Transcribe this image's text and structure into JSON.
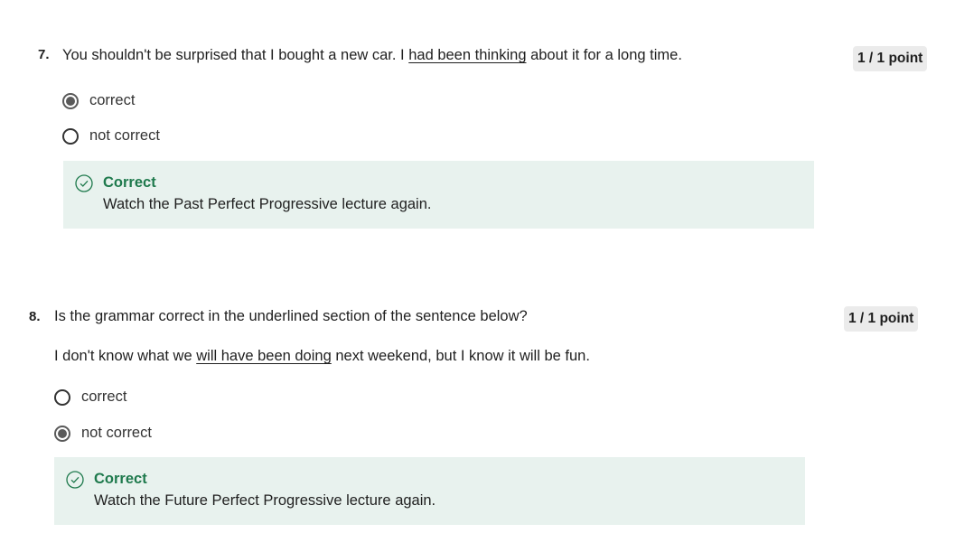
{
  "questions": [
    {
      "number": "7.",
      "prompt_parts": [
        "You shouldn't be surprised that I bought a new car. I ",
        "had been thinking",
        " about it for a long time."
      ],
      "points": "1 / 1 point",
      "options": [
        {
          "label": "correct",
          "checked": true
        },
        {
          "label": "not correct",
          "checked": false
        }
      ],
      "feedback": {
        "title": "Correct",
        "text": "Watch the Past Perfect Progressive lecture again."
      }
    },
    {
      "number": "8.",
      "prompt": "Is the grammar correct in the underlined section of the sentence below?",
      "sentence_parts": [
        "I don't know what we ",
        "will have been doing",
        " next weekend, but I know it will be fun."
      ],
      "points": "1 / 1 point",
      "options": [
        {
          "label": "correct",
          "checked": false
        },
        {
          "label": "not correct",
          "checked": true
        }
      ],
      "feedback": {
        "title": "Correct",
        "text": "Watch the Future Perfect Progressive lecture again."
      }
    }
  ],
  "icons": {
    "feedback": "check-circle-icon"
  },
  "colors": {
    "feedback_bg": "#e8f2ee",
    "correct_green": "#1f7a4d",
    "points_bg": "#ebebeb"
  }
}
